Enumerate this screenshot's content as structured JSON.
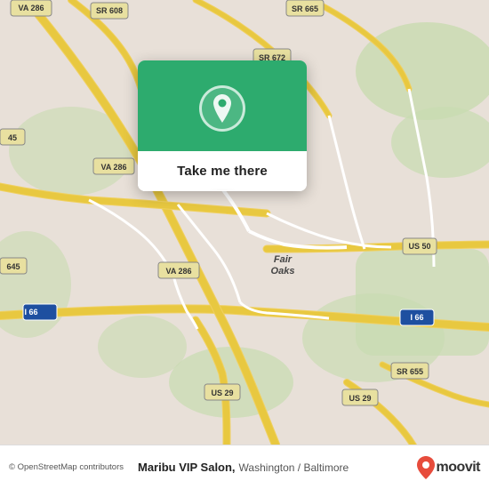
{
  "map": {
    "background_color": "#e8e0d8"
  },
  "popup": {
    "button_label": "Take me there",
    "icon_name": "location-pin-icon"
  },
  "bottom_bar": {
    "attribution_text": "© OpenStreetMap contributors",
    "business_name": "Maribu VIP Salon,",
    "business_location": "Washington / Baltimore",
    "moovit_text": "moovit"
  },
  "road_labels": {
    "va286_1": "VA 286",
    "va286_2": "VA 286",
    "va286_3": "VA 286",
    "sr608": "SR 608",
    "sr665": "SR 665",
    "sr672": "SR 672",
    "sr655": "SR 655",
    "i66_1": "I 66",
    "i66_2": "I 66",
    "us50": "US 50",
    "us29_1": "US 29",
    "us29_2": "US 29",
    "i45": "45",
    "i645": "645",
    "fair_oaks": "Fair Oaks"
  }
}
